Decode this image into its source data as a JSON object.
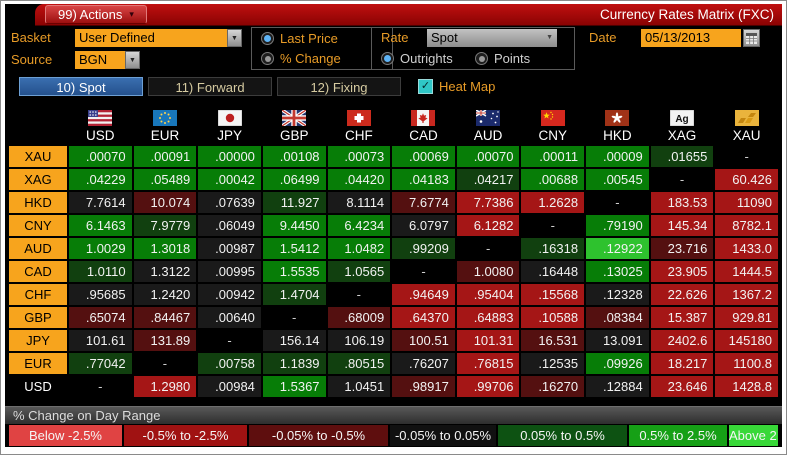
{
  "titlebar": {
    "actions_label": "99) Actions",
    "title": "Currency Rates Matrix (FXC)"
  },
  "controls": {
    "basket_label": "Basket",
    "basket_value": "User Defined",
    "source_label": "Source",
    "source_value": "BGN",
    "last_price_label": "Last Price",
    "pct_change_label": "% Change",
    "price_selected": "Last Price",
    "rate_label": "Rate",
    "rate_value": "Spot",
    "outrights_label": "Outrights",
    "points_label": "Points",
    "rate_selected": "Outrights",
    "date_label": "Date",
    "date_value": "05/13/2013"
  },
  "tabs": [
    {
      "label": "10) Spot",
      "active": true
    },
    {
      "label": "11) Forward",
      "active": false
    },
    {
      "label": "12) Fixing",
      "active": false
    }
  ],
  "heatmap": {
    "label": "Heat Map",
    "checked": true,
    "check_glyph": "✓"
  },
  "colors": {
    "g1": "#077d07",
    "g2": "#11400f",
    "g3": "#2ec22e",
    "k": "#1a1a1a",
    "d": "#000000",
    "r1": "#a51616",
    "r2": "#541010"
  },
  "matrix": {
    "columns": [
      "USD",
      "EUR",
      "JPY",
      "GBP",
      "CHF",
      "CAD",
      "AUD",
      "CNY",
      "HKD",
      "XAG",
      "XAU"
    ],
    "rows": [
      {
        "label": "XAU",
        "cells": [
          [
            ".00070",
            "g1"
          ],
          [
            ".00091",
            "g1"
          ],
          [
            ".00000",
            "g1"
          ],
          [
            ".00108",
            "g1"
          ],
          [
            ".00073",
            "g1"
          ],
          [
            ".00069",
            "g1"
          ],
          [
            ".00070",
            "g1"
          ],
          [
            ".00011",
            "g1"
          ],
          [
            ".00009",
            "g1"
          ],
          [
            ".01655",
            "g2"
          ],
          [
            "-",
            "d"
          ]
        ]
      },
      {
        "label": "XAG",
        "cells": [
          [
            ".04229",
            "g1"
          ],
          [
            ".05489",
            "g1"
          ],
          [
            ".00042",
            "g1"
          ],
          [
            ".06499",
            "g1"
          ],
          [
            ".04420",
            "g1"
          ],
          [
            ".04183",
            "g1"
          ],
          [
            ".04217",
            "g2"
          ],
          [
            ".00688",
            "g1"
          ],
          [
            ".00545",
            "g1"
          ],
          [
            "-",
            "d"
          ],
          [
            "60.426",
            "r1"
          ]
        ]
      },
      {
        "label": "HKD",
        "cells": [
          [
            "7.7614",
            "k"
          ],
          [
            "10.074",
            "r2"
          ],
          [
            ".07639",
            "k"
          ],
          [
            "11.927",
            "g2"
          ],
          [
            "8.1114",
            "k"
          ],
          [
            "7.6774",
            "r2"
          ],
          [
            "7.7386",
            "r1"
          ],
          [
            "1.2628",
            "r1"
          ],
          [
            "-",
            "d"
          ],
          [
            "183.53",
            "r1"
          ],
          [
            "11090",
            "r1"
          ]
        ]
      },
      {
        "label": "CNY",
        "cells": [
          [
            "6.1463",
            "g1"
          ],
          [
            "7.9779",
            "g2"
          ],
          [
            ".06049",
            "k"
          ],
          [
            "9.4450",
            "g1"
          ],
          [
            "6.4234",
            "g1"
          ],
          [
            "6.0797",
            "k"
          ],
          [
            "6.1282",
            "r1"
          ],
          [
            "-",
            "d"
          ],
          [
            ".79190",
            "g1"
          ],
          [
            "145.34",
            "r1"
          ],
          [
            "8782.1",
            "r1"
          ]
        ]
      },
      {
        "label": "AUD",
        "cells": [
          [
            "1.0029",
            "g1"
          ],
          [
            "1.3018",
            "g1"
          ],
          [
            ".00987",
            "k"
          ],
          [
            "1.5412",
            "g1"
          ],
          [
            "1.0482",
            "g1"
          ],
          [
            ".99209",
            "g2"
          ],
          [
            "-",
            "d"
          ],
          [
            ".16318",
            "g2"
          ],
          [
            ".12922",
            "g3"
          ],
          [
            "23.716",
            "r2"
          ],
          [
            "1433.0",
            "r1"
          ]
        ]
      },
      {
        "label": "CAD",
        "cells": [
          [
            "1.0110",
            "g2"
          ],
          [
            "1.3122",
            "k"
          ],
          [
            ".00995",
            "k"
          ],
          [
            "1.5535",
            "g1"
          ],
          [
            "1.0565",
            "g2"
          ],
          [
            "-",
            "d"
          ],
          [
            "1.0080",
            "r2"
          ],
          [
            ".16448",
            "k"
          ],
          [
            ".13025",
            "g1"
          ],
          [
            "23.905",
            "r1"
          ],
          [
            "1444.5",
            "r1"
          ]
        ]
      },
      {
        "label": "CHF",
        "cells": [
          [
            ".95685",
            "k"
          ],
          [
            "1.2420",
            "k"
          ],
          [
            ".00942",
            "k"
          ],
          [
            "1.4704",
            "g2"
          ],
          [
            "-",
            "d"
          ],
          [
            ".94649",
            "r1"
          ],
          [
            ".95404",
            "r1"
          ],
          [
            ".15568",
            "r1"
          ],
          [
            ".12328",
            "k"
          ],
          [
            "22.626",
            "r1"
          ],
          [
            "1367.2",
            "r1"
          ]
        ]
      },
      {
        "label": "GBP",
        "cells": [
          [
            ".65074",
            "r2"
          ],
          [
            ".84467",
            "r2"
          ],
          [
            ".00640",
            "k"
          ],
          [
            "-",
            "d"
          ],
          [
            ".68009",
            "r2"
          ],
          [
            ".64370",
            "r1"
          ],
          [
            ".64883",
            "r1"
          ],
          [
            ".10588",
            "r1"
          ],
          [
            ".08384",
            "r2"
          ],
          [
            "15.387",
            "r1"
          ],
          [
            "929.81",
            "r1"
          ]
        ]
      },
      {
        "label": "JPY",
        "cells": [
          [
            "101.61",
            "k"
          ],
          [
            "131.89",
            "r2"
          ],
          [
            "-",
            "d"
          ],
          [
            "156.14",
            "k"
          ],
          [
            "106.19",
            "k"
          ],
          [
            "100.51",
            "r2"
          ],
          [
            "101.31",
            "r1"
          ],
          [
            "16.531",
            "r2"
          ],
          [
            "13.091",
            "k"
          ],
          [
            "2402.6",
            "r1"
          ],
          [
            "145180",
            "r1"
          ]
        ]
      },
      {
        "label": "EUR",
        "cells": [
          [
            ".77042",
            "g2"
          ],
          [
            "-",
            "d"
          ],
          [
            ".00758",
            "g2"
          ],
          [
            "1.1839",
            "g2"
          ],
          [
            ".80515",
            "g2"
          ],
          [
            ".76207",
            "k"
          ],
          [
            ".76815",
            "r1"
          ],
          [
            ".12535",
            "k"
          ],
          [
            ".09926",
            "g1"
          ],
          [
            "18.217",
            "r1"
          ],
          [
            "1100.8",
            "r1"
          ]
        ]
      },
      {
        "label": "USD",
        "plain": true,
        "cells": [
          [
            "-",
            "d"
          ],
          [
            "1.2980",
            "r1"
          ],
          [
            ".00984",
            "k"
          ],
          [
            "1.5367",
            "g1"
          ],
          [
            "1.0451",
            "k"
          ],
          [
            ".98917",
            "r2"
          ],
          [
            ".99706",
            "r1"
          ],
          [
            ".16270",
            "r2"
          ],
          [
            ".12884",
            "k"
          ],
          [
            "23.646",
            "r1"
          ],
          [
            "1428.8",
            "r1"
          ]
        ]
      }
    ]
  },
  "legend": {
    "title": "% Change on Day Range",
    "items": [
      {
        "label": "Below -2.5%",
        "color": "#e04343"
      },
      {
        "label": "-0.5% to -2.5%",
        "color": "#a01212"
      },
      {
        "label": "-0.05% to -0.5%",
        "color": "#5e0e0e"
      },
      {
        "label": "-0.05% to 0.05%",
        "color": "#111111"
      },
      {
        "label": "0.05% to 0.5%",
        "color": "#0d5212"
      },
      {
        "label": "0.5% to 2.5%",
        "color": "#16a016"
      },
      {
        "label": "Above 2.5%",
        "color": "#38d838"
      }
    ]
  }
}
